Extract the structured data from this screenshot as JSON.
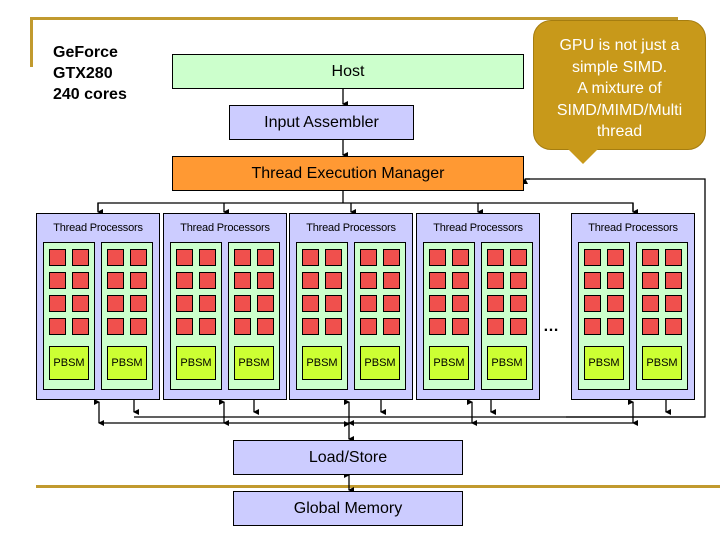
{
  "title": {
    "lines": [
      "GeForce",
      "GTX280",
      "240 cores"
    ]
  },
  "blocks": {
    "host": "Host",
    "input_assembler": "Input Assembler",
    "thread_execution_manager": "Thread Execution Manager",
    "load_store": "Load/Store",
    "global_memory": "Global Memory"
  },
  "callout": {
    "lines": [
      "GPU is not just a",
      "simple SIMD.",
      "A mixture of",
      "SIMD/MIMD/Multi",
      "thread"
    ]
  },
  "clusters": [
    {
      "label": "Thread Processors",
      "pbsm": [
        "PBSM",
        "PBSM"
      ]
    },
    {
      "label": "Thread Processors",
      "pbsm": [
        "PBSM",
        "PBSM"
      ]
    },
    {
      "label": "Thread Processors",
      "pbsm": [
        "PBSM",
        "PBSM"
      ]
    },
    {
      "label": "Thread Processors",
      "pbsm": [
        "PBSM",
        "PBSM"
      ]
    },
    {
      "label": "Thread Processors",
      "pbsm": [
        "PBSM",
        "PBSM"
      ]
    }
  ],
  "ellipsis": "…",
  "colors": {
    "host": "#ccffcc",
    "assembler": "#ccccff",
    "manager": "#ff9933",
    "processor": "#f0504d",
    "pbsm": "#ccff33",
    "callout": "#c8991a",
    "accent_line": "#c19a2e"
  }
}
